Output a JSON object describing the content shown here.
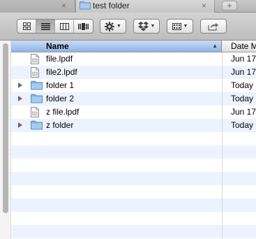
{
  "tabs": [
    {
      "title": "",
      "close": "×"
    },
    {
      "title": "test folder",
      "close": "×",
      "active": true
    }
  ],
  "new_tab": "+",
  "toolbar": {
    "views": [
      "icon-view-icon",
      "list-view-icon",
      "column-view-icon",
      "cover-flow-icon"
    ],
    "active_view": 1,
    "action_icon": "gear-icon",
    "dropbox_icon": "dropbox-icon",
    "arrange_icon": "arrange-grid-icon",
    "share_icon": "share-icon"
  },
  "list": {
    "columns": {
      "name": "Name",
      "date": "Date Modified"
    },
    "sort_indicator": "▲",
    "rows": [
      {
        "name": "file.lpdf",
        "date": "Jun 17",
        "kind": "file"
      },
      {
        "name": "file2.lpdf",
        "date": "Jun 17",
        "kind": "file"
      },
      {
        "name": "folder 1",
        "date": "Today",
        "kind": "folder"
      },
      {
        "name": "folder 2",
        "date": "Today",
        "kind": "folder"
      },
      {
        "name": "z file.lpdf",
        "date": "Jun 17",
        "kind": "file"
      },
      {
        "name": "z folder",
        "date": "Today",
        "kind": "folder"
      }
    ]
  },
  "colors": {
    "header_selected": "#a5c4ee",
    "stripe": "#edf3fe",
    "folder": "#8cbbe8"
  }
}
